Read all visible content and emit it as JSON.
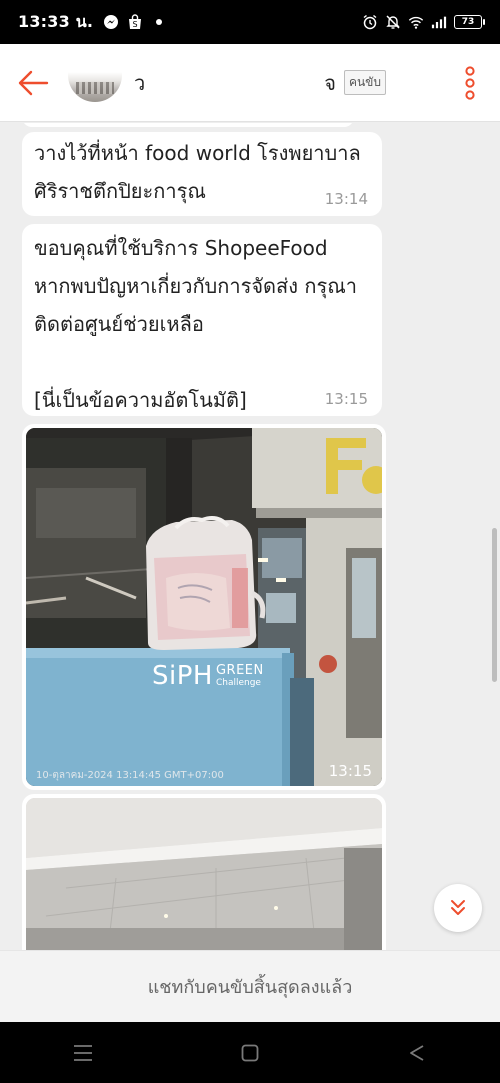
{
  "status_bar": {
    "time": "13:33 น.",
    "battery": "73",
    "icons_left": [
      "messenger-icon",
      "shopee-icon",
      "dot-icon"
    ],
    "icons_right": [
      "alarm-icon",
      "mute-icon",
      "wifi-icon",
      "signal-icon",
      "battery-icon"
    ]
  },
  "header": {
    "name_left": "ว",
    "name_right": "จ",
    "role_badge": "คนขับ"
  },
  "messages": [
    {
      "lines": [
        "วางไว้ที่หน้า food world โรงพยาบาล",
        "ศิริราชตึกปิยะการุณ"
      ],
      "time": "13:14"
    },
    {
      "lines": [
        "ขอบคุณที่ใช้บริการ ShopeeFood",
        "หากพบปัญหาเกี่ยวกับการจัดส่ง กรุณา",
        "ติดต่อศูนย์ช่วยเหลือ",
        "",
        "[นี่เป็นข้อความอัตโนมัติ]"
      ],
      "time": "13:15"
    }
  ],
  "photo_1": {
    "sign_main": "SiPH",
    "sign_top": "GREEN",
    "sign_sub": "Challenge",
    "store_letters": "Fo",
    "timestamp_overlay": "10-ตุลาคม-2024 13:14:45 GMT+07:00",
    "time": "13:15"
  },
  "footer": {
    "chat_ended": "แชทกับคนขับสิ้นสุดลงแล้ว"
  },
  "colors": {
    "accent": "#ee4d2d",
    "bubble": "#ffffff",
    "background": "#eeeeee"
  }
}
